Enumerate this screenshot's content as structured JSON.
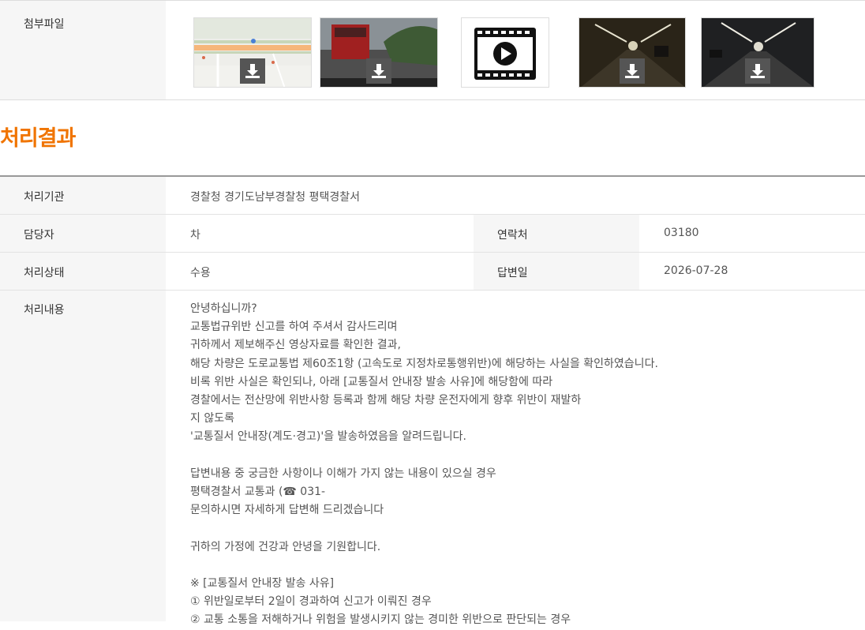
{
  "attachments": {
    "label": "첨부파일",
    "items": [
      {
        "type": "map",
        "icon": "download-icon"
      },
      {
        "type": "bus-photo",
        "icon": "download-icon"
      },
      {
        "type": "video",
        "icon": "video-play-icon"
      },
      {
        "type": "tunnel-photo",
        "icon": "download-icon"
      },
      {
        "type": "tunnel-photo",
        "icon": "download-icon"
      }
    ]
  },
  "result": {
    "title": "처리결과",
    "agency_label": "처리기관",
    "agency_value": "경찰청 경기도남부경찰청 평택경찰서",
    "manager_label": "담당자",
    "manager_value": "차",
    "contact_label": "연락처",
    "contact_value": "03180",
    "status_label": "처리상태",
    "status_value": "수용",
    "reply_date_label": "답변일",
    "reply_date_value": "2026-07-28",
    "content_label": "처리내용",
    "content_lines": [
      "안녕하십니까?",
      "교통법규위반 신고를 하여 주셔서 감사드리며",
      "귀하께서 제보해주신 영상자료를 확인한 결과,",
      "해당 차량은 도로교통법 제60조1항 (고속도로 지정차로통행위반)에 해당하는 사실을 확인하였습니다.",
      "비록 위반 사실은 확인되나, 아래 [교통질서 안내장 발송 사유]에 해당함에 따라",
      "경찰에서는 전산망에 위반사항 등록과 함께 해당 차량 운전자에게 향후 위반이 재발하",
      "지 않도록",
      "'교통질서 안내장(계도·경고)'을 발송하였음을 알려드립니다.",
      "",
      "답변내용 중 궁금한 사항이나 이해가 가지 않는 내용이 있으실 경우",
      "평택경찰서 교통과 (☎ 031-",
      "문의하시면 자세하게 답변해 드리겠습니다",
      "",
      "귀하의 가정에 건강과 안녕을 기원합니다.",
      "",
      "※ [교통질서 안내장 발송 사유]",
      "① 위반일로부터 2일이 경과하여 신고가 이뤄진 경우",
      "② 교통 소통을 저해하거나 위험을 발생시키지 않는 경미한 위반으로 판단되는 경우"
    ]
  },
  "colors": {
    "accent": "#f07400",
    "label_bg": "#f6f6f6"
  }
}
